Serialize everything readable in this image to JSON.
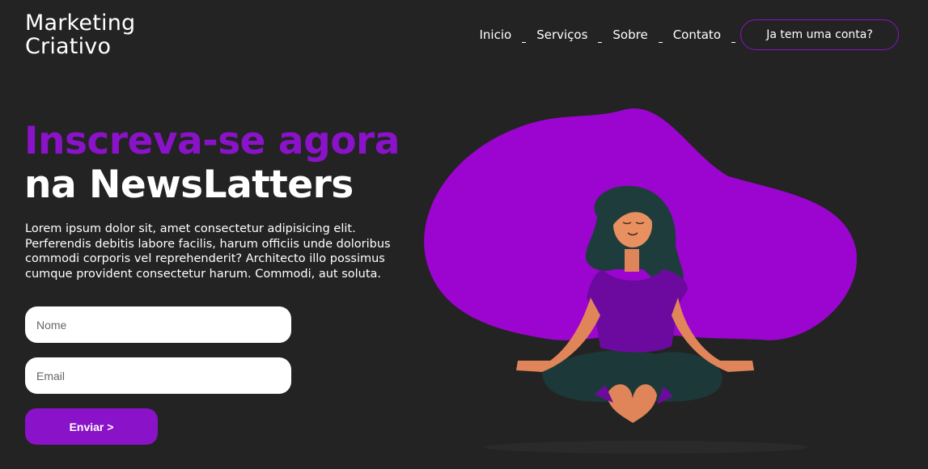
{
  "header": {
    "logo_line1": "Marketing",
    "logo_line2": "Criativo",
    "nav": [
      {
        "label": "Inicio"
      },
      {
        "label": "Serviços"
      },
      {
        "label": "Sobre"
      },
      {
        "label": "Contato"
      }
    ],
    "account_button": "Ja tem uma conta?"
  },
  "hero": {
    "title_line1": "Inscreva-se agora",
    "title_line2": "na NewsLatters",
    "text": "Lorem ipsum dolor sit, amet consectetur adipisicing elit. Perferendis debitis labore facilis, harum officiis unde doloribus commodi corporis vel reprehenderit? Architecto illo possimus cumque provident consectetur harum. Commodi, aut soluta."
  },
  "form": {
    "name_placeholder": "Nome",
    "email_placeholder": "Email",
    "submit_label": "Enviar >"
  },
  "colors": {
    "background": "#232323",
    "accent": "#8a12c8",
    "blob": "#9b05cf"
  },
  "illustration": {
    "icon": "meditating-woman-illustration"
  }
}
